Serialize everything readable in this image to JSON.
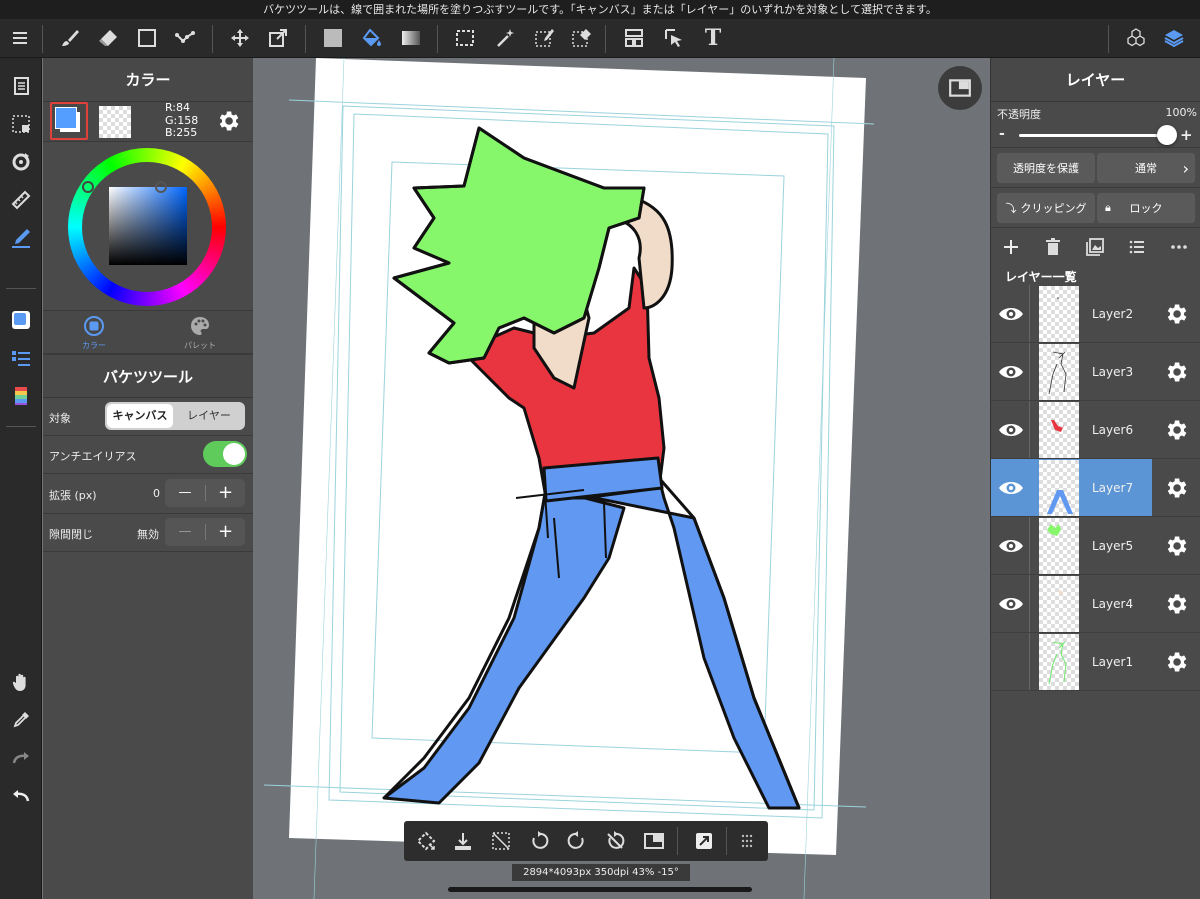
{
  "hint_bar": {
    "text": "バケツツールは、線で囲まれた場所を塗りつぶすツールです。「キャンバス」または「レイヤー」のいずれかを対象として選択できます。"
  },
  "toolbar": {
    "icons": [
      "menu-icon",
      "brush-icon",
      "eraser-icon",
      "rectangle-icon",
      "dot-tool-icon",
      "move-icon",
      "transform-icon",
      "fill-color-icon",
      "bucket-icon",
      "gradient-icon",
      "selection-icon",
      "magic-wand-icon",
      "select-pen-icon",
      "select-eraser-icon",
      "layout-icon",
      "select-layer-icon",
      "text-icon",
      "3d-material-icon",
      "layers-icon"
    ],
    "text_icon_label": "T"
  },
  "color_panel": {
    "title": "カラー",
    "r_label": "R:84",
    "g_label": "G:158",
    "b_label": "B:255",
    "current_color": "#549eff",
    "tab_color": "カラー",
    "tab_palette": "パレット"
  },
  "bucket_panel": {
    "title": "バケツツール",
    "target_label": "対象",
    "target_options": [
      "キャンバス",
      "レイヤー"
    ],
    "target_selected": "キャンバス",
    "antialias_label": "アンチエイリアス",
    "antialias_on": true,
    "expand_label": "拡張 (px)",
    "expand_value": "0",
    "gap_label": "隙間閉じ",
    "gap_value": "無効",
    "minus": "—",
    "plus": "+"
  },
  "layer_panel": {
    "title": "レイヤー",
    "opacity_label": "不透明度",
    "opacity_value": "100%",
    "opacity_fraction": 1.0,
    "minus": "-",
    "plus": "+",
    "protect_alpha": "透明度を保護",
    "blend_mode": "通常",
    "clipping": "クリッピング",
    "lock": "ロック",
    "list_title": "レイヤー一覧",
    "layers": [
      {
        "name": "Layer2",
        "visible": true,
        "selected": false
      },
      {
        "name": "Layer3",
        "visible": true,
        "selected": false
      },
      {
        "name": "Layer6",
        "visible": true,
        "selected": false
      },
      {
        "name": "Layer7",
        "visible": true,
        "selected": true
      },
      {
        "name": "Layer5",
        "visible": true,
        "selected": false
      },
      {
        "name": "Layer4",
        "visible": true,
        "selected": false
      },
      {
        "name": "Layer1",
        "visible": false,
        "selected": false
      }
    ]
  },
  "canvas": {
    "status": "2894*4093px 350dpi 43% -15°"
  },
  "colors": {
    "hair": "#86f76b",
    "shirt": "#e8353f",
    "jeans": "#6098f2",
    "skin": "#f0dcc8",
    "selected_layer": "#5b95d5",
    "toggle_on": "#5fcb5b"
  }
}
